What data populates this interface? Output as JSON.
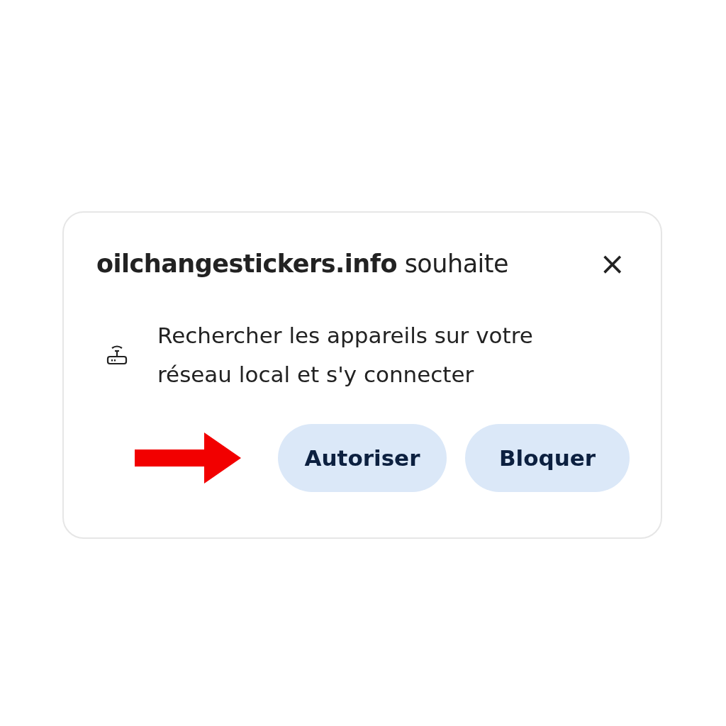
{
  "dialog": {
    "title": "**oilchangestickers.info** souhaite",
    "close": "×",
    "permission": "Rechercher les appareils sur votre réseau local et s'y connecter",
    "buttons": [
      {
        "label": "Autoriser",
        "kind": "allow"
      },
      {
        "label": "Bloquer",
        "kind": "block"
      }
    ]
  }
}
